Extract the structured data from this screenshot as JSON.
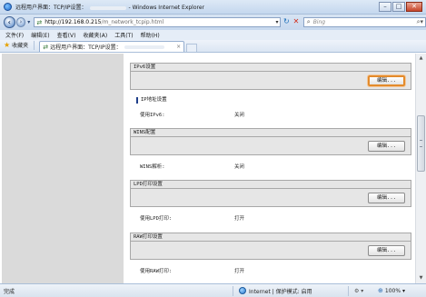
{
  "window": {
    "title_prefix": "远程用户界面：TCP/IP设置：",
    "title_suffix": "- Windows Internet Explorer",
    "min_label": "–",
    "max_label": "□",
    "close_label": "✕"
  },
  "address": {
    "host": "http://192.168.0.215",
    "path": "/m_network_tcpip.html",
    "dropdown": "▾",
    "refresh": "↻",
    "stop": "✕"
  },
  "search": {
    "placeholder": "Bing",
    "go": "⌕▾"
  },
  "menu": {
    "items": [
      "文件(F)",
      "编辑(E)",
      "查看(V)",
      "收藏夹(A)",
      "工具(T)",
      "帮助(H)"
    ]
  },
  "favorites": {
    "label": "收藏夹"
  },
  "tab": {
    "title": "远程用户界面：TCP/IP设置：",
    "close": "×"
  },
  "sections": {
    "ipv6": {
      "header": "IPv6设置",
      "edit_label": "编辑...",
      "subheading": "IP地址设置",
      "field_label": "使用IPv6:",
      "field_value": "关闭"
    },
    "wins": {
      "header": "WINS配置",
      "edit_label": "编辑...",
      "field_label": "WINS解析:",
      "field_value": "关闭"
    },
    "lpd": {
      "header": "LPD打印设置",
      "edit_label": "编辑...",
      "field_label": "使用LPD打印:",
      "field_value": "打开"
    },
    "raw": {
      "header": "RAW打印设置",
      "edit_label": "编辑...",
      "field_label": "使用RAW打印:",
      "field_value": "打开"
    }
  },
  "status": {
    "text": "完成",
    "zone": "Internet | 保护模式: 启用",
    "protect": "⚙ ▾",
    "zoom": "100%",
    "zoom_suffix": "▾"
  },
  "colors": {
    "focus_outline": "#e38b2c",
    "section_bg": "#e6e6e6",
    "sidebar_bg": "#dadada"
  }
}
